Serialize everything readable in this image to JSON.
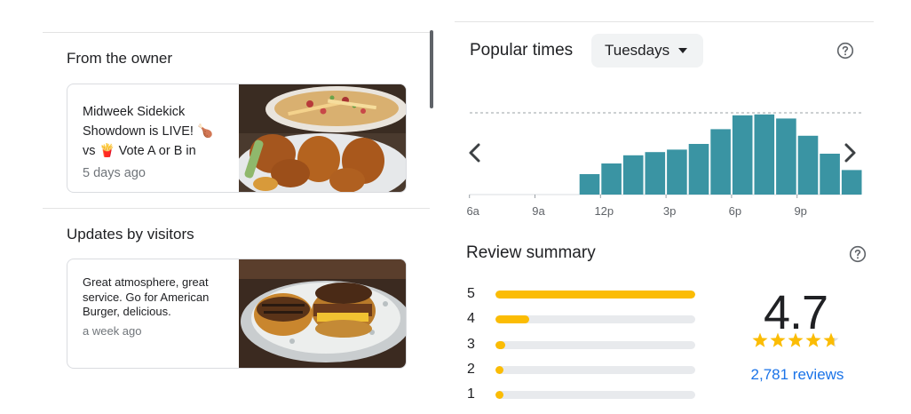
{
  "owner_section": {
    "title": "From the owner",
    "post": {
      "lines": [
        "Midweek Sidekick",
        "Showdown is LIVE! 🍗",
        "vs 🍟 Vote A or B in"
      ],
      "time": "5 days ago"
    }
  },
  "visitors_section": {
    "title": "Updates by visitors",
    "post": {
      "lines": [
        "Great atmosphere, great",
        "service. Go for American",
        "Burger, delicious."
      ],
      "time": "a week ago"
    }
  },
  "popular_times": {
    "title": "Popular times",
    "day_selector": "Tuesdays",
    "icons": {
      "help": "help-circle-icon",
      "prev": "chevron-left-icon",
      "next": "chevron-right-icon",
      "dropdown": "caret-down-icon"
    }
  },
  "chart_data": {
    "type": "bar",
    "title": "Popular times",
    "x_tick_labels": [
      "6a",
      "9a",
      "12p",
      "3p",
      "6p",
      "9p"
    ],
    "hours": [
      "6a",
      "7a",
      "8a",
      "9a",
      "10a",
      "11a",
      "12p",
      "1p",
      "2p",
      "3p",
      "4p",
      "5p",
      "6p",
      "7p",
      "8p",
      "9p",
      "10p",
      "11p"
    ],
    "values": [
      0,
      0,
      0,
      0,
      0,
      25,
      38,
      48,
      52,
      55,
      62,
      80,
      97,
      98,
      93,
      72,
      50,
      30
    ],
    "ylim": [
      0,
      100
    ],
    "max_reference_line": "dashed",
    "bar_color": "#3a94a3",
    "baseline_color": "#dadce0"
  },
  "review_summary": {
    "title": "Review summary",
    "average": "4.7",
    "stars": 4.7,
    "count_text": "2,781 reviews",
    "star_color": "#fbbc04",
    "link_color": "#1a73e8",
    "distribution": [
      {
        "stars": "5",
        "fraction": 1.0
      },
      {
        "stars": "4",
        "fraction": 0.17
      },
      {
        "stars": "3",
        "fraction": 0.05
      },
      {
        "stars": "2",
        "fraction": 0.025
      },
      {
        "stars": "1",
        "fraction": 0.035
      }
    ]
  }
}
